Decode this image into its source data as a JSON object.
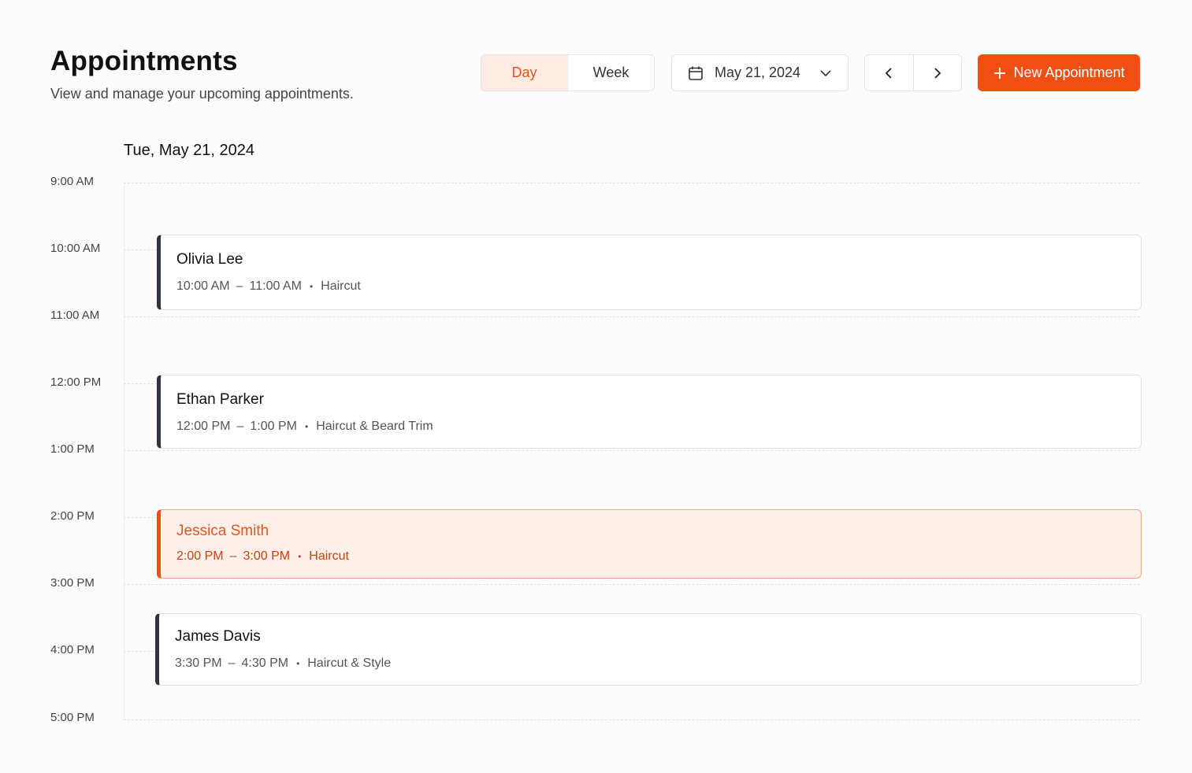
{
  "header": {
    "title": "Appointments",
    "subtitle": "View and manage your upcoming appointments."
  },
  "toolbar": {
    "view_day": "Day",
    "view_week": "Week",
    "selected_view": "Day",
    "date": "May 21, 2024",
    "new_appointment": "New Appointment"
  },
  "schedule": {
    "day_heading": "Tue, May 21, 2024",
    "times": [
      "9:00 AM",
      "10:00 AM",
      "11:00 AM",
      "12:00 PM",
      "1:00 PM",
      "2:00 PM",
      "3:00 PM",
      "4:00 PM",
      "5:00 PM"
    ],
    "appointments": [
      {
        "name": "Olivia Lee",
        "start": "10:00 AM",
        "end": "11:00 AM",
        "service": "Haircut",
        "highlighted": false
      },
      {
        "name": "Ethan Parker",
        "start": "12:00 PM",
        "end": "1:00 PM",
        "service": "Haircut & Beard Trim",
        "highlighted": false
      },
      {
        "name": "Jessica Smith",
        "start": "2:00 PM",
        "end": "3:00 PM",
        "service": "Haircut",
        "highlighted": true
      },
      {
        "name": "James Davis",
        "start": "3:30 PM",
        "end": "4:30 PM",
        "service": "Haircut & Style",
        "highlighted": false
      }
    ]
  },
  "colors": {
    "accent": "#ef4f13",
    "accent_soft": "#fdece3",
    "neutral_bar": "#2f3440"
  },
  "icons": {
    "date_picker": "calendar-icon",
    "dropdown": "chevron-down-icon",
    "previous": "chevron-left-icon",
    "next": "chevron-right-icon",
    "new": "plus-icon"
  }
}
